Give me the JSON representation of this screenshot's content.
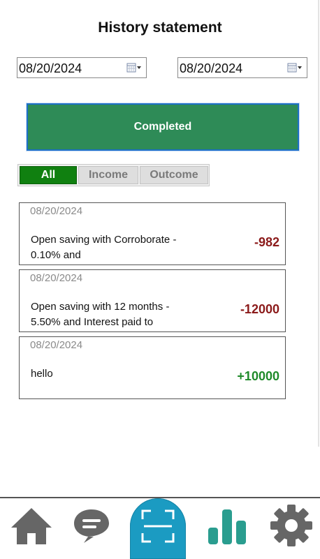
{
  "header": {
    "title": "History statement"
  },
  "date_range": {
    "from": "08/20/2024",
    "to": "08/20/2024",
    "calendar_icon": "calendar-icon"
  },
  "status_button": {
    "label": "Completed",
    "color": "#2e8b57"
  },
  "filters": {
    "tabs": [
      "All",
      "Income",
      "Outcome"
    ],
    "active": "All",
    "active_color": "#108010"
  },
  "transactions": [
    {
      "date": "08/20/2024",
      "description": "Open saving with Corroborate - 0.10% and",
      "amount": "-982",
      "type": "debit"
    },
    {
      "date": "08/20/2024",
      "description": "Open saving with 12 months - 5.50% and Interest paid to",
      "amount": "-12000",
      "type": "debit"
    },
    {
      "date": "08/20/2024",
      "description": "hello",
      "amount": "+10000",
      "type": "credit"
    }
  ],
  "colors": {
    "debit": "#8b1a1a",
    "credit": "#1f8a2a",
    "nav_gray": "#666666",
    "nav_teal": "#2a9d8f",
    "scan_blue": "#1b9bc2"
  },
  "bottom_nav": {
    "items": [
      {
        "icon": "home-icon"
      },
      {
        "icon": "chat-icon"
      },
      {
        "icon": "scan-icon"
      },
      {
        "icon": "bar-chart-icon"
      },
      {
        "icon": "gear-icon"
      }
    ]
  }
}
